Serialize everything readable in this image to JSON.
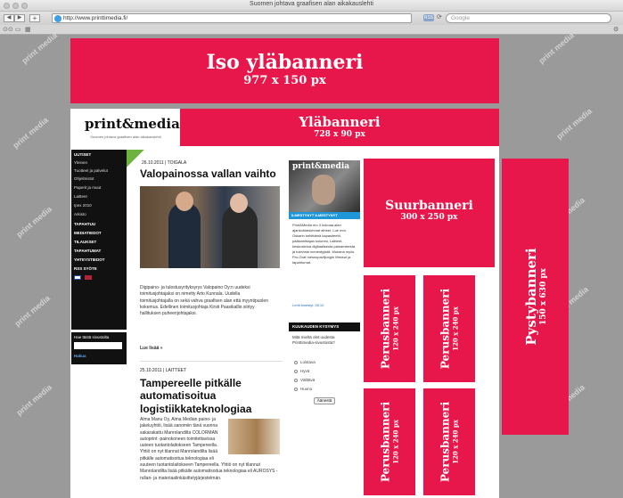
{
  "browser": {
    "title": "Suomen johtava graafisen alan aikakauslehti",
    "url": "http://www.printtimedia.fi/",
    "search_placeholder": "Google",
    "rss_label": "RSS",
    "nav_back": "◀",
    "nav_forward": "▶",
    "add_tab": "+",
    "reload_icon": "reload-icon",
    "bookmark_icons": [
      "reading-list-icon",
      "bookmarks-icon",
      "top-sites-icon"
    ],
    "gear_icon": "gear-icon"
  },
  "ads": {
    "top_big": {
      "name": "Iso yläbanneri",
      "size": "977 x 150 px"
    },
    "top": {
      "name": "Yläbanneri",
      "size": "728 x 90 px"
    },
    "large": {
      "name": "Suurbanneri",
      "size": "300 x 250 px"
    },
    "vertical": {
      "name": "Pystybanneri",
      "size": "150 x 630 px"
    },
    "basic": [
      {
        "name": "Perusbanneri",
        "size": "120 x 240 px"
      },
      {
        "name": "Perusbanneri",
        "size": "120 x 240 px"
      },
      {
        "name": "Perusbanneri",
        "size": "120 x 240 px"
      },
      {
        "name": "Perusbanneri",
        "size": "120 x 240 px"
      }
    ],
    "color": "#e8174b"
  },
  "site": {
    "logo": "print&media",
    "logo_tagline": "Suomen johtava graafisen alan aikakauslehti",
    "nav": [
      {
        "label": "UUTISET",
        "head": true
      },
      {
        "label": "Yleinen",
        "head": false
      },
      {
        "label": "Tuotteet ja palvelut",
        "head": false
      },
      {
        "label": "Ohjelmistot",
        "head": false
      },
      {
        "label": "Paperit ja muut",
        "head": false
      },
      {
        "label": "Laitteet",
        "head": false
      },
      {
        "label": "Ipex 2010",
        "head": false
      },
      {
        "label": "Arkisto",
        "head": false
      },
      {
        "label": "TAPAHTUU",
        "head": true
      },
      {
        "label": "MEDIATIEDOT",
        "head": true
      },
      {
        "label": "TILAUKSET",
        "head": true
      },
      {
        "label": "TAPAHTUMAT",
        "head": true
      },
      {
        "label": "YHTEYSTIEDOT",
        "head": true
      },
      {
        "label": "RSS SYÖTE",
        "head": true
      }
    ],
    "side_search": {
      "label": "Hae tästä sivustolta",
      "button": "Hakua"
    }
  },
  "articles": [
    {
      "meta": "26.10.2011 | TOIGALA",
      "title": "Valopainossa vallan vaihto",
      "body": "Digipaino- ja tulostusyrityksyrys Valopaino Oy:n uudeksi toimitusjohtajaksi on nimetty Arto Kunnala. Uudella toimitusjohtajalla on sekä vahva graafisen alan että myyntipuolen kokemus. Edellinen toimitusjohtaja Kirsti Paasikallio siirtyy hallituksen puheenjohtajaksi.",
      "read_more": "Lue lisää »"
    },
    {
      "meta": "25.10.2011 | LAITTEET",
      "title": "Tampereelle pitkälle automatisoitua logistiikkateknologiaa",
      "body": "Alma Manu Oy, Alma Median paino- ja jakeluyhtiö, lisää sanomiin tänä vuonna sakarakattu Manrolandilta COLORMAN autoprint -painokoneen toimitettavissa uuteen tuotantolaitokseen Tampereella. Yhtiö on nyt tilannut Manrolandilta lisää pitkälle automatisoitua teknologiaa eli AUROSYS -rullan- ja materiaalinkäsittelyjärjestelmän."
    }
  ],
  "magazine": {
    "logo": "print&media",
    "strip": "ILMESTYNYT ILMESTYNYT",
    "text": "Print&Media nro 3 kokoaa alan ajankohtaisimmat aiheet. Lue mm. Oskarin kehittämä kapasiteetti, päätoimittajan kolumni, Laitteet-keskustelua digitaalisesta painamisesta ja tulevista menestyjistä. Mukana myös Pro-Graf messupaviljongin Messut ja tapahtumat.",
    "link": "Lehti ilmestyi: 28.10"
  },
  "poll": {
    "header": "KUUKAUDEN KYSYMYS",
    "question": "Mitä mieltä olet uudesta Printtimedia-sivustosta?",
    "options": [
      "Loistava",
      "Hyvä",
      "Välttävä",
      "Huono"
    ],
    "button": "Äänestä"
  }
}
